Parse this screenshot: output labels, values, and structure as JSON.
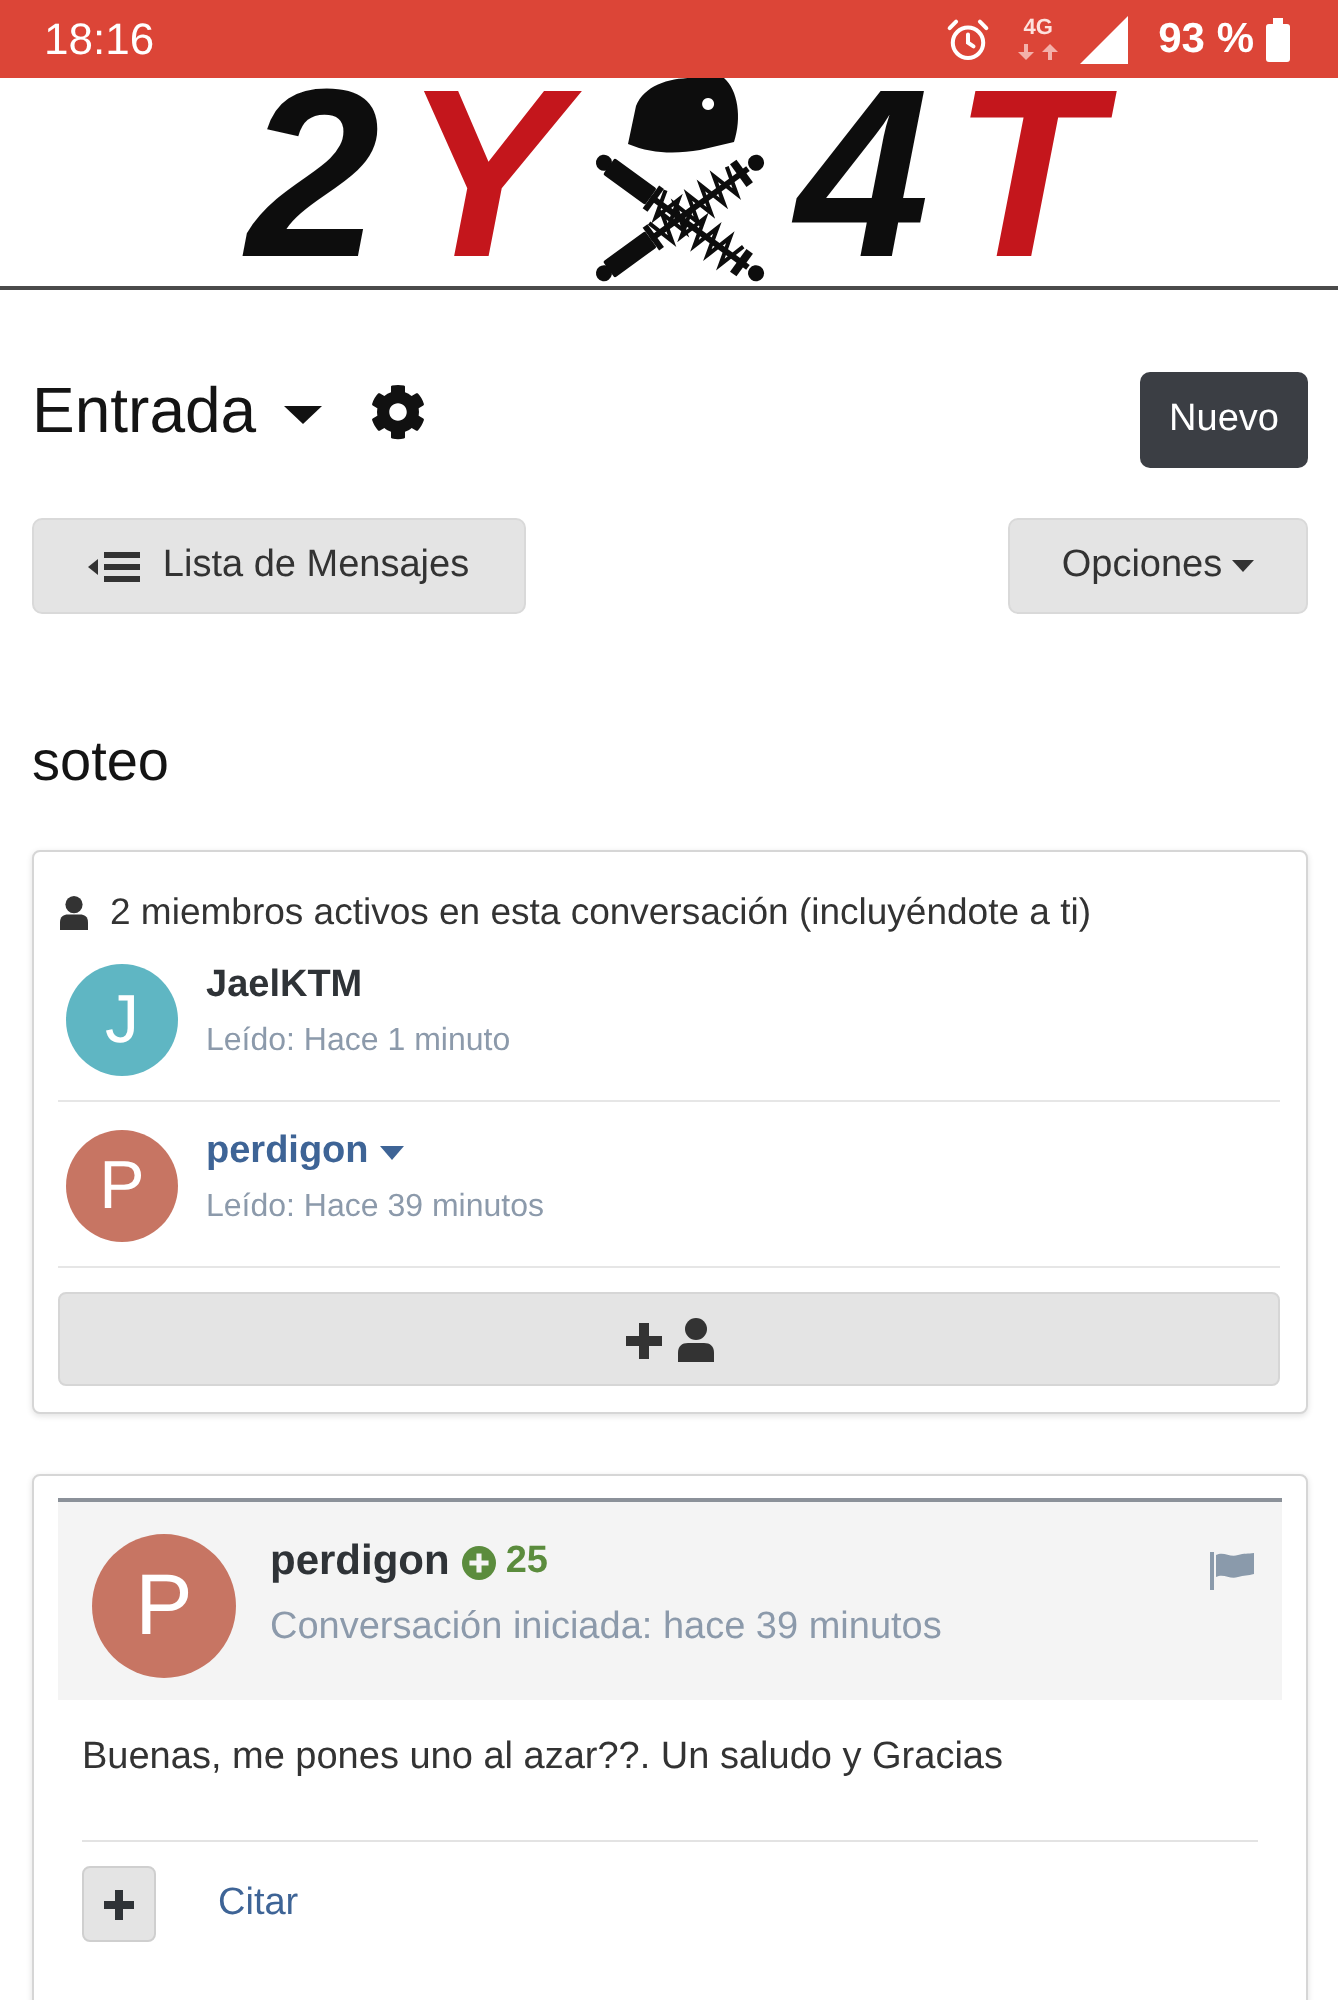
{
  "status_bar": {
    "time": "18:16",
    "network": "4G",
    "battery": "93 %"
  },
  "logo": {
    "left": [
      {
        "text": "2",
        "color": "#0d0d0d"
      },
      {
        "text": "Y",
        "color": "#c4161c"
      }
    ],
    "right": [
      {
        "text": "4",
        "color": "#0d0d0d"
      },
      {
        "text": "T",
        "color": "#c4161c"
      }
    ]
  },
  "header": {
    "folder": "Entrada",
    "new_button": "Nuevo"
  },
  "toolbar": {
    "back_button": "Lista de Mensajes",
    "options_button": "Opciones"
  },
  "conversation": {
    "title": "soteo",
    "participants": {
      "summary": "2 miembros activos en esta conversación (incluyéndote a ti)",
      "members": [
        {
          "initial": "J",
          "name": "JaelKTM",
          "read": "Leído: Hace 1 minuto",
          "color": "#5fb6c3",
          "has_menu": false
        },
        {
          "initial": "P",
          "name": "perdigon",
          "read": "Leído: Hace 39 minutos",
          "color": "#c77563",
          "has_menu": true
        }
      ]
    }
  },
  "messages": [
    {
      "initial": "P",
      "color": "#c77563",
      "author": "perdigon",
      "reputation": "25",
      "started": "Conversación iniciada: hace 39 minutos",
      "body": "Buenas, me pones uno al azar??. Un saludo y Gracias",
      "quote_link": "Citar"
    }
  ]
}
